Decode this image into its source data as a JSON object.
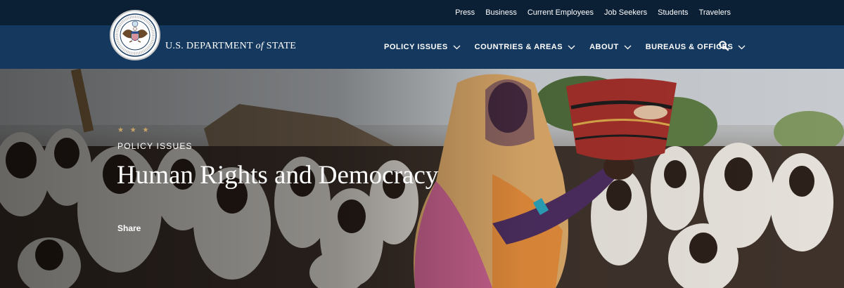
{
  "utility_nav": [
    "Press",
    "Business",
    "Current Employees",
    "Job Seekers",
    "Students",
    "Travelers"
  ],
  "header": {
    "seal_icon": "department-of-state-seal",
    "wordmark_prefix": "U.S. DEPARTMENT",
    "wordmark_of": "of",
    "wordmark_suffix": "STATE"
  },
  "main_nav": [
    "POLICY ISSUES",
    "COUNTRIES & AREAS",
    "ABOUT",
    "BUREAUS & OFFICES"
  ],
  "search_icon": "search-icon",
  "hero": {
    "stars": "★ ★ ★",
    "eyebrow": "POLICY ISSUES",
    "title": "Human Rights and Democracy",
    "share_label": "Share"
  },
  "colors": {
    "utility_bg": "#0b1f35",
    "header_bg": "#14385e",
    "star_gold": "#c9a56a"
  }
}
